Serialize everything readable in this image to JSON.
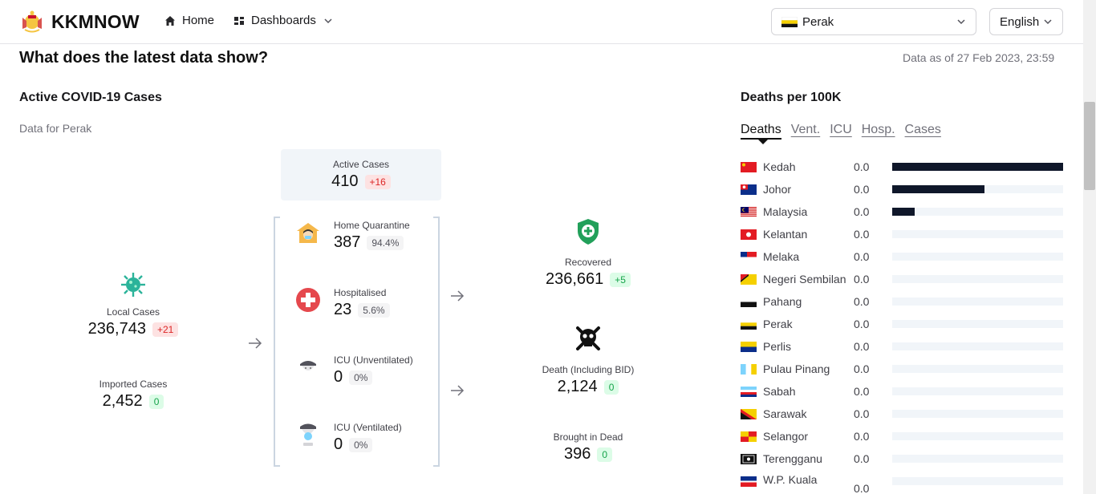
{
  "nav": {
    "brand": "KKMNOW",
    "home": "Home",
    "dashboards": "Dashboards",
    "state_selected": "Perak",
    "language": "English"
  },
  "header": {
    "title": "What does the latest data show?",
    "data_as_of": "Data as of 27 Feb 2023, 23:59"
  },
  "active": {
    "title": "Active COVID-19 Cases",
    "data_for": "Data for Perak",
    "local": {
      "label": "Local Cases",
      "value": "236,743",
      "delta": "+21"
    },
    "imported": {
      "label": "Imported Cases",
      "value": "2,452",
      "delta": "0"
    },
    "active_cases": {
      "label": "Active Cases",
      "value": "410",
      "delta": "+16"
    },
    "home_quarantine": {
      "label": "Home Quarantine",
      "value": "387",
      "pct": "94.4%"
    },
    "hospitalised": {
      "label": "Hospitalised",
      "value": "23",
      "pct": "5.6%"
    },
    "icu_unvent": {
      "label": "ICU (Unventilated)",
      "value": "0",
      "pct": "0%"
    },
    "icu_vent": {
      "label": "ICU (Ventilated)",
      "value": "0",
      "pct": "0%"
    },
    "recovered": {
      "label": "Recovered",
      "value": "236,661",
      "delta": "+5"
    },
    "death": {
      "label": "Death (Including BID)",
      "value": "2,124",
      "delta": "0"
    },
    "bid": {
      "label": "Brought in Dead",
      "value": "396",
      "delta": "0"
    }
  },
  "deaths": {
    "title": "Deaths per 100K",
    "tabs": [
      "Deaths",
      "Vent.",
      "ICU",
      "Hosp.",
      "Cases"
    ],
    "active_tab": "Deaths",
    "rows": [
      {
        "name": "Kedah",
        "value": "0.0",
        "fraction": 1.0
      },
      {
        "name": "Johor",
        "value": "0.0",
        "fraction": 0.54
      },
      {
        "name": "Malaysia",
        "value": "0.0",
        "fraction": 0.13
      },
      {
        "name": "Kelantan",
        "value": "0.0",
        "fraction": 0
      },
      {
        "name": "Melaka",
        "value": "0.0",
        "fraction": 0
      },
      {
        "name": "Negeri Sembilan",
        "value": "0.0",
        "fraction": 0
      },
      {
        "name": "Pahang",
        "value": "0.0",
        "fraction": 0
      },
      {
        "name": "Perak",
        "value": "0.0",
        "fraction": 0
      },
      {
        "name": "Perlis",
        "value": "0.0",
        "fraction": 0
      },
      {
        "name": "Pulau Pinang",
        "value": "0.0",
        "fraction": 0
      },
      {
        "name": "Sabah",
        "value": "0.0",
        "fraction": 0
      },
      {
        "name": "Sarawak",
        "value": "0.0",
        "fraction": 0
      },
      {
        "name": "Selangor",
        "value": "0.0",
        "fraction": 0
      },
      {
        "name": "Terengganu",
        "value": "0.0",
        "fraction": 0
      },
      {
        "name": "W.P. Kuala",
        "value": "0.0",
        "fraction": 0
      }
    ]
  },
  "colors": {
    "bar": "#0f172a",
    "track": "#f1f5f9",
    "red_badge": "#fde2e2",
    "green_badge": "#dcfce7",
    "virus": "#2bb39a",
    "recovered_shield": "#22a05a"
  }
}
